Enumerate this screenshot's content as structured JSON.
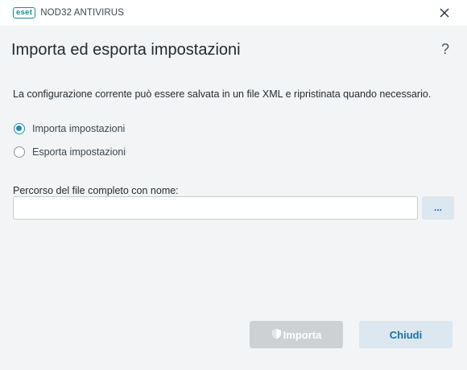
{
  "window": {
    "logo_text": "eset",
    "product_name": "NOD32 ANTIVIRUS"
  },
  "dialog": {
    "title": "Importa ed esporta impostazioni",
    "help_label": "?",
    "description": "La configurazione corrente può essere salvata in un file XML e ripristinata quando necessario.",
    "options": [
      {
        "label": "Importa impostazioni",
        "selected": true
      },
      {
        "label": "Esporta impostazioni",
        "selected": false
      }
    ],
    "path": {
      "label": "Percorso del file completo con nome:",
      "value": "",
      "browse_label": "..."
    },
    "buttons": {
      "import_label": "Importa",
      "import_enabled": false,
      "close_label": "Chiudi"
    }
  },
  "colors": {
    "accent": "#1a8fb8",
    "brand": "#1a8a9a",
    "button_secondary_bg": "#dce7ef",
    "button_disabled_bg": "#cdd1d4",
    "background": "#f3f4f5"
  }
}
